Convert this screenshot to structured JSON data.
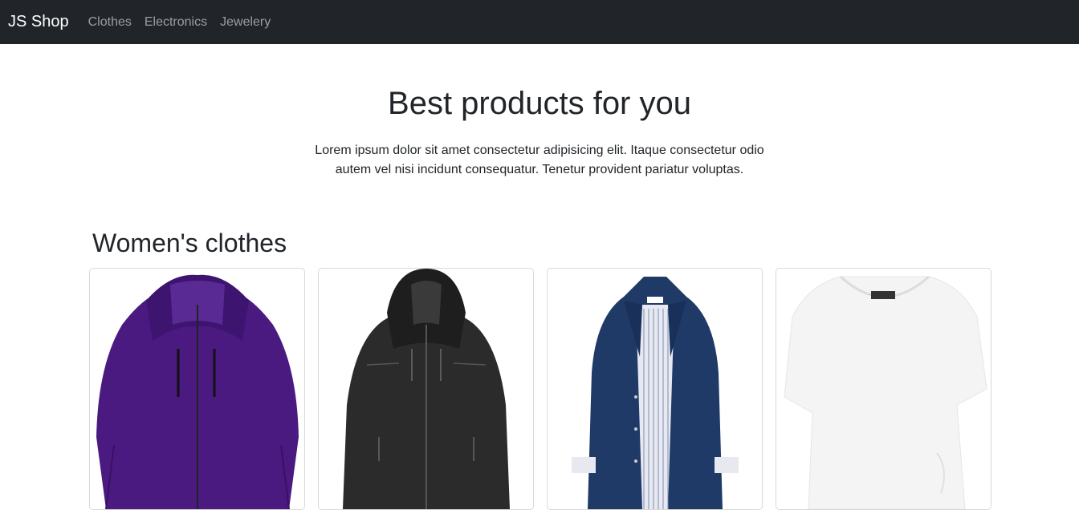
{
  "navbar": {
    "brand": "JS Shop",
    "links": [
      "Clothes",
      "Electronics",
      "Jewelery"
    ]
  },
  "hero": {
    "title": "Best products for you",
    "text": "Lorem ipsum dolor sit amet consectetur adipisicing elit. Itaque consectetur odio autem vel nisi incidunt consequatur. Tenetur provident pariatur voluptas."
  },
  "section": {
    "title": "Women's clothes",
    "products": [
      {
        "image": "purple-jacket",
        "color": "#4a1a80"
      },
      {
        "image": "black-leather-jacket",
        "color": "#2a2a2a"
      },
      {
        "image": "navy-trench-jacket",
        "color": "#1f3a66"
      },
      {
        "image": "white-tshirt",
        "color": "#f4f4f4"
      }
    ]
  }
}
